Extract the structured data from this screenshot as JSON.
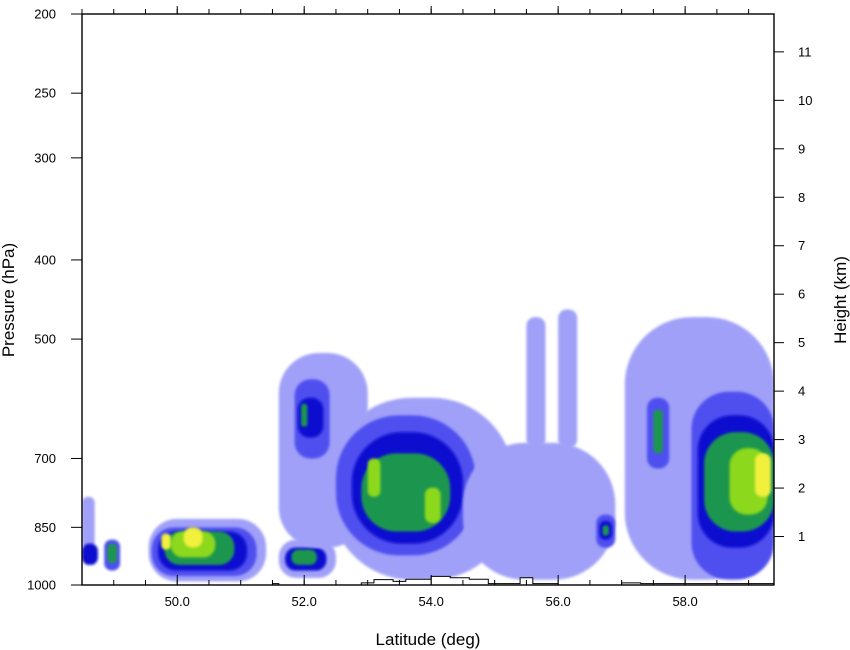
{
  "chart_data": {
    "type": "heatmap",
    "title": "",
    "xlabel": "Latitude (deg)",
    "ylabel_left": "Pressure (hPa)",
    "ylabel_right": "Height (km)",
    "xlim": [
      48.5,
      59.4
    ],
    "ylim_pressure": [
      1000,
      200
    ],
    "y_scale": "log-pressure",
    "x_ticks": [
      {
        "value": 50,
        "label": "50.0"
      },
      {
        "value": 52,
        "label": "52.0"
      },
      {
        "value": 54,
        "label": "54.0"
      },
      {
        "value": 56,
        "label": "56.0"
      },
      {
        "value": 58,
        "label": "58.0"
      }
    ],
    "x_minor_step": 0.5,
    "pressure_ticks": [
      {
        "value": 200,
        "label": "200"
      },
      {
        "value": 250,
        "label": "250"
      },
      {
        "value": 300,
        "label": "300"
      },
      {
        "value": 400,
        "label": "400"
      },
      {
        "value": 500,
        "label": "500"
      },
      {
        "value": 700,
        "label": "700"
      },
      {
        "value": 850,
        "label": "850"
      },
      {
        "value": 1000,
        "label": "1000"
      }
    ],
    "height_ticks": [
      {
        "value": 1,
        "label": "1"
      },
      {
        "value": 2,
        "label": "2"
      },
      {
        "value": 3,
        "label": "3"
      },
      {
        "value": 4,
        "label": "4"
      },
      {
        "value": 5,
        "label": "5"
      },
      {
        "value": 6,
        "label": "6"
      },
      {
        "value": 7,
        "label": "7"
      },
      {
        "value": 8,
        "label": "8"
      },
      {
        "value": 9,
        "label": "9"
      },
      {
        "value": 10,
        "label": "10"
      },
      {
        "value": 11,
        "label": "11"
      }
    ],
    "levels": [
      1,
      2,
      3,
      4,
      5
    ],
    "level_colors": [
      "#a0a0f8",
      "#5050f0",
      "#0a0ad0",
      "#1e9650",
      "#8cd81e",
      "#f0f03c"
    ],
    "grid": false,
    "legend": "none",
    "regions": [
      {
        "lat": [
          48.5,
          48.7
        ],
        "p": [
          900,
          780
        ],
        "level": 1
      },
      {
        "lat": [
          48.5,
          48.75
        ],
        "p": [
          945,
          890
        ],
        "level": 3
      },
      {
        "lat": [
          48.85,
          49.1
        ],
        "p": [
          960,
          880
        ],
        "level": 2
      },
      {
        "lat": [
          48.9,
          49.05
        ],
        "p": [
          940,
          890
        ],
        "level": 4
      },
      {
        "lat": [
          49.55,
          51.4
        ],
        "p": [
          990,
          830
        ],
        "level": 1
      },
      {
        "lat": [
          49.6,
          51.25
        ],
        "p": [
          975,
          850
        ],
        "level": 2
      },
      {
        "lat": [
          49.7,
          51.1
        ],
        "p": [
          960,
          860
        ],
        "level": 3
      },
      {
        "lat": [
          49.8,
          50.9
        ],
        "p": [
          945,
          860
        ],
        "level": 4
      },
      {
        "lat": [
          49.9,
          50.6
        ],
        "p": [
          925,
          860
        ],
        "level": 5
      },
      {
        "lat": [
          50.1,
          50.4
        ],
        "p": [
          900,
          850
        ],
        "level": 6
      },
      {
        "lat": [
          49.75,
          49.9
        ],
        "p": [
          905,
          865
        ],
        "level": 6
      },
      {
        "lat": [
          51.6,
          52.5
        ],
        "p": [
          980,
          880
        ],
        "level": 1
      },
      {
        "lat": [
          51.7,
          52.35
        ],
        "p": [
          960,
          900
        ],
        "level": 3
      },
      {
        "lat": [
          51.8,
          52.2
        ],
        "p": [
          945,
          905
        ],
        "level": 4
      },
      {
        "lat": [
          51.6,
          53.0
        ],
        "p": [
          900,
          520
        ],
        "level": 1
      },
      {
        "lat": [
          51.85,
          52.4
        ],
        "p": [
          700,
          560
        ],
        "level": 2
      },
      {
        "lat": [
          51.9,
          52.3
        ],
        "p": [
          660,
          590
        ],
        "level": 3
      },
      {
        "lat": [
          51.95,
          52.05
        ],
        "p": [
          640,
          600
        ],
        "level": 4
      },
      {
        "lat": [
          52.4,
          55.3
        ],
        "p": [
          985,
          590
        ],
        "level": 1
      },
      {
        "lat": [
          52.5,
          54.7
        ],
        "p": [
          920,
          620
        ],
        "level": 2
      },
      {
        "lat": [
          52.75,
          54.5
        ],
        "p": [
          890,
          650
        ],
        "level": 3
      },
      {
        "lat": [
          52.9,
          54.3
        ],
        "p": [
          860,
          690
        ],
        "level": 4
      },
      {
        "lat": [
          53.0,
          53.2
        ],
        "p": [
          780,
          700
        ],
        "level": 5
      },
      {
        "lat": [
          53.9,
          54.15
        ],
        "p": [
          840,
          760
        ],
        "level": 5
      },
      {
        "lat": [
          54.5,
          56.9
        ],
        "p": [
          985,
          670
        ],
        "level": 1
      },
      {
        "lat": [
          55.5,
          55.8
        ],
        "p": [
          680,
          470
        ],
        "level": 1
      },
      {
        "lat": [
          56.0,
          56.3
        ],
        "p": [
          680,
          460
        ],
        "level": 1
      },
      {
        "lat": [
          56.6,
          56.9
        ],
        "p": [
          900,
          820
        ],
        "level": 2
      },
      {
        "lat": [
          56.65,
          56.85
        ],
        "p": [
          880,
          835
        ],
        "level": 3
      },
      {
        "lat": [
          56.7,
          56.8
        ],
        "p": [
          870,
          845
        ],
        "level": 4
      },
      {
        "lat": [
          57.05,
          59.4
        ],
        "p": [
          985,
          470
        ],
        "level": 1
      },
      {
        "lat": [
          57.4,
          57.75
        ],
        "p": [
          720,
          590
        ],
        "level": 2
      },
      {
        "lat": [
          57.5,
          57.65
        ],
        "p": [
          690,
          610
        ],
        "level": 4
      },
      {
        "lat": [
          58.1,
          59.4
        ],
        "p": [
          985,
          580
        ],
        "level": 2
      },
      {
        "lat": [
          58.2,
          59.4
        ],
        "p": [
          900,
          620
        ],
        "level": 3
      },
      {
        "lat": [
          58.3,
          59.4
        ],
        "p": [
          860,
          650
        ],
        "level": 4
      },
      {
        "lat": [
          58.7,
          59.3
        ],
        "p": [
          820,
          680
        ],
        "level": 5
      },
      {
        "lat": [
          59.1,
          59.35
        ],
        "p": [
          780,
          690
        ],
        "level": 6
      }
    ],
    "terrain_hpa": [
      {
        "lat": 48.5,
        "p": 1000
      },
      {
        "lat": 51.5,
        "p": 1000
      },
      {
        "lat": 51.5,
        "p": 996
      },
      {
        "lat": 51.6,
        "p": 996
      },
      {
        "lat": 51.6,
        "p": 1000
      },
      {
        "lat": 52.9,
        "p": 1000
      },
      {
        "lat": 52.9,
        "p": 994
      },
      {
        "lat": 53.1,
        "p": 994
      },
      {
        "lat": 53.1,
        "p": 985
      },
      {
        "lat": 53.4,
        "p": 985
      },
      {
        "lat": 53.4,
        "p": 990
      },
      {
        "lat": 53.6,
        "p": 990
      },
      {
        "lat": 53.6,
        "p": 984
      },
      {
        "lat": 54.0,
        "p": 984
      },
      {
        "lat": 54.0,
        "p": 976
      },
      {
        "lat": 54.3,
        "p": 976
      },
      {
        "lat": 54.3,
        "p": 980
      },
      {
        "lat": 54.6,
        "p": 980
      },
      {
        "lat": 54.6,
        "p": 984
      },
      {
        "lat": 54.9,
        "p": 984
      },
      {
        "lat": 54.9,
        "p": 996
      },
      {
        "lat": 55.4,
        "p": 996
      },
      {
        "lat": 55.4,
        "p": 980
      },
      {
        "lat": 55.6,
        "p": 980
      },
      {
        "lat": 55.6,
        "p": 996
      },
      {
        "lat": 56.0,
        "p": 996
      },
      {
        "lat": 56.0,
        "p": 1000
      },
      {
        "lat": 57.0,
        "p": 1000
      },
      {
        "lat": 57.0,
        "p": 994
      },
      {
        "lat": 57.3,
        "p": 994
      },
      {
        "lat": 57.3,
        "p": 996
      },
      {
        "lat": 59.4,
        "p": 996
      },
      {
        "lat": 59.4,
        "p": 1000
      }
    ]
  }
}
